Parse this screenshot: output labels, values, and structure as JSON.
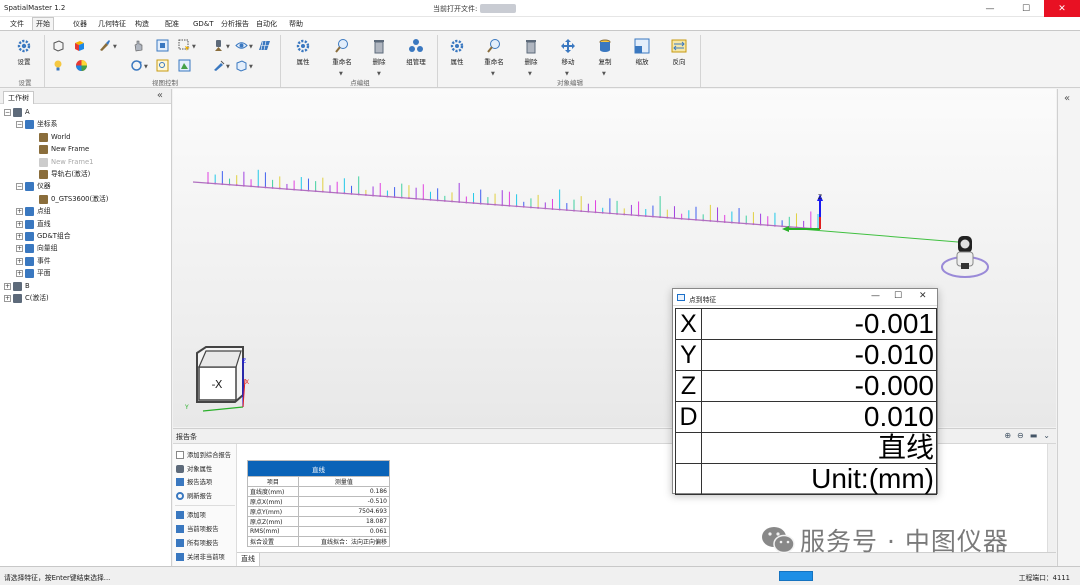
{
  "window": {
    "title": "SpatialMaster 1.2",
    "file_label": "当前打开文件:",
    "controls": {
      "minimize": "—",
      "maximize": "☐",
      "close": "✕"
    }
  },
  "menu": [
    "文件",
    "开始",
    "仪器",
    "几何特征",
    "构造",
    "配准",
    "GD&T",
    "分析报告",
    "自动化",
    "帮助"
  ],
  "menu_active": "开始",
  "ribbon": {
    "settings_label": "设置",
    "groups": {
      "settings": "设置",
      "view": "视图控制",
      "point_group": "点编组",
      "object_edit": "对象编辑"
    },
    "point_group_buttons": [
      "属性",
      "重命名",
      "删除",
      "组管理"
    ],
    "object_buttons": [
      "属性",
      "重命名",
      "删除",
      "移动",
      "复制",
      "缩放",
      "反向"
    ]
  },
  "tree": {
    "tab": "工作树",
    "items": [
      {
        "label": "A",
        "level": 0,
        "exp": "−"
      },
      {
        "label": "坐标系",
        "level": 1,
        "exp": "−"
      },
      {
        "label": "World",
        "level": 2,
        "exp": ""
      },
      {
        "label": "New Frame",
        "level": 2,
        "exp": ""
      },
      {
        "label": "New Frame1",
        "level": 2,
        "exp": "",
        "dim": true
      },
      {
        "label": "导轨右(激活)",
        "level": 2,
        "exp": ""
      },
      {
        "label": "仪器",
        "level": 1,
        "exp": "−"
      },
      {
        "label": "0_GTS3600(激活)",
        "level": 2,
        "exp": ""
      },
      {
        "label": "点组",
        "level": 1,
        "exp": "+"
      },
      {
        "label": "直线",
        "level": 1,
        "exp": "+"
      },
      {
        "label": "GD&T组合",
        "level": 1,
        "exp": "+"
      },
      {
        "label": "向量组",
        "level": 1,
        "exp": "+"
      },
      {
        "label": "事件",
        "level": 1,
        "exp": "+"
      },
      {
        "label": "平面",
        "level": 1,
        "exp": "+"
      },
      {
        "label": "B",
        "level": 0,
        "exp": "+"
      },
      {
        "label": "C(激活)",
        "level": 0,
        "exp": "+"
      }
    ]
  },
  "viewport": {
    "view_cube_face": "-X",
    "axis_z": "Z",
    "axis_x": "X",
    "axis_y": "Y"
  },
  "report": {
    "title": "报告条",
    "side_items": [
      "添加到综合报告",
      "对象属性",
      "报告选项",
      "刷新报告",
      "添加项",
      "当前项报告",
      "所有项报告",
      "关闭非当前项"
    ],
    "table_title": "直线",
    "columns": [
      "项目",
      "测量值"
    ],
    "rows": [
      [
        "直线度(mm)",
        "0.186"
      ],
      [
        "原点X(mm)",
        "-0.510"
      ],
      [
        "原点Y(mm)",
        "7504.693"
      ],
      [
        "原点Z(mm)",
        "18.087"
      ],
      [
        "RMS(mm)",
        "0.061"
      ],
      [
        "拟合设置",
        "直线拟合：法向正向偏移"
      ]
    ],
    "bottom_tab": "直线"
  },
  "status": {
    "text": "请选择特征，按Enter键结束选择...",
    "port_label": "工程端口：4111"
  },
  "dialog": {
    "title": "点到特征",
    "rows": [
      {
        "key": "X",
        "value": "-0.001"
      },
      {
        "key": "Y",
        "value": "-0.010"
      },
      {
        "key": "Z",
        "value": "-0.000"
      },
      {
        "key": "D",
        "value": "0.010"
      },
      {
        "key": "",
        "value": "直线"
      },
      {
        "key": "",
        "value": "Unit:(mm)"
      }
    ]
  },
  "watermark": "服务号 · 中图仪器",
  "colors": {
    "accent": "#0a63b8",
    "close": "#e81123",
    "progress": "#1e8fe6",
    "vector_magenta": "#e040e0",
    "vector_cyan": "#20c8e8"
  }
}
